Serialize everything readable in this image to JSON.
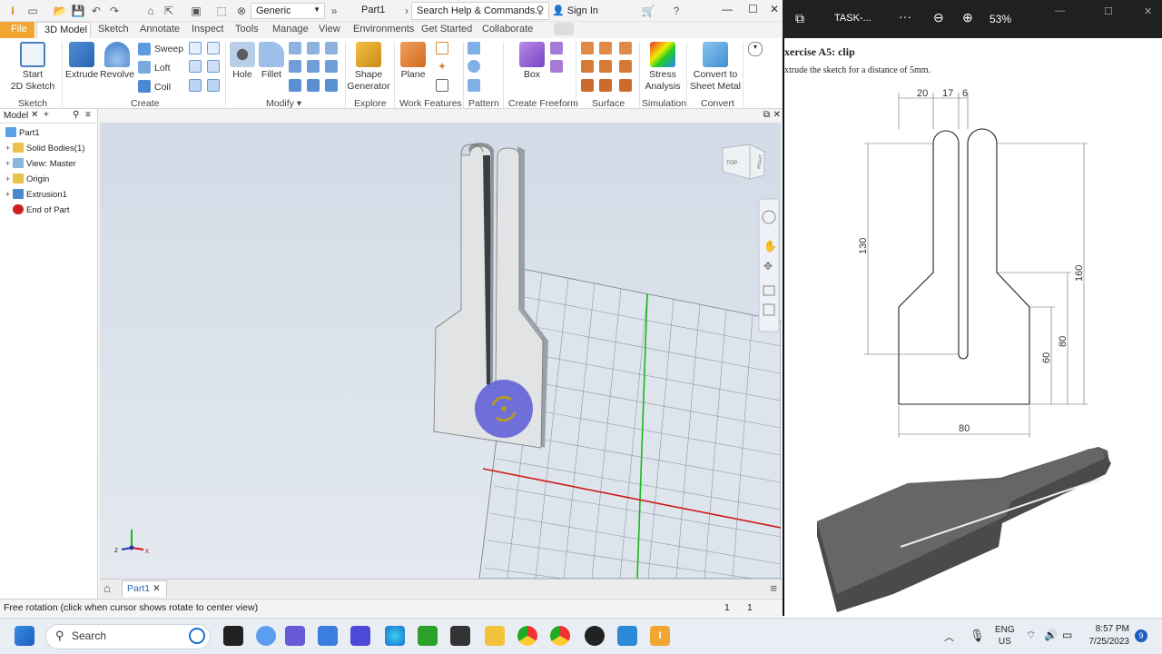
{
  "qat": {
    "style_value": "Generic",
    "doc_title": "Part1",
    "search_placeholder": "Search Help & Commands...",
    "sign_in": "Sign In"
  },
  "tabs": [
    "File",
    "3D Model",
    "Sketch",
    "Annotate",
    "Inspect",
    "Tools",
    "Manage",
    "View",
    "Environments",
    "Get Started",
    "Collaborate"
  ],
  "ribbon": {
    "start_sketch": "Start\n2D Sketch",
    "extrude": "Extrude",
    "revolve": "Revolve",
    "sweep": "Sweep",
    "loft": "Loft",
    "coil": "Coil",
    "hole": "Hole",
    "fillet": "Fillet",
    "shape_generator": "Shape\nGenerator",
    "plane": "Plane",
    "box": "Box",
    "stress_analysis": "Stress\nAnalysis",
    "convert_sheet_metal": "Convert to\nSheet Metal",
    "groups": {
      "sketch": "Sketch",
      "create": "Create",
      "modify": "Modify",
      "explore": "Explore",
      "work_features": "Work Features",
      "pattern": "Pattern",
      "create_freeform": "Create Freeform",
      "surface": "Surface",
      "simulation": "Simulation",
      "convert": "Convert"
    }
  },
  "browser": {
    "title": "Model",
    "nodes": [
      "Part1",
      "Solid Bodies(1)",
      "View: Master",
      "Origin",
      "Extrusion1",
      "End of Part"
    ]
  },
  "viewcube": {
    "top": "TOP",
    "right": "RIGHT"
  },
  "doc_tab": "Part1",
  "status": {
    "text": "Free rotation (click when cursor shows rotate to center view)",
    "count1": "1",
    "count2": "1"
  },
  "pdf": {
    "title": "TASK-...",
    "zoom": "53%",
    "heading": "xercise A5: clip",
    "instruction": "xtrude the sketch for a distance of 5mm.",
    "dims": {
      "d20": "20",
      "d17": "17",
      "d6": "6",
      "d130": "130",
      "d160": "160",
      "d80v": "80",
      "d60": "60",
      "d80h": "80"
    }
  },
  "taskbar": {
    "search": "Search",
    "lang1": "ENG",
    "lang2": "US",
    "time": "8:57 PM",
    "date": "7/25/2023",
    "badge": "9"
  },
  "colors": {
    "file_tab": "#f0a630",
    "x_axis": "#d01818",
    "y_axis": "#18b818",
    "orbit_cursor": "#5b5bd8"
  }
}
